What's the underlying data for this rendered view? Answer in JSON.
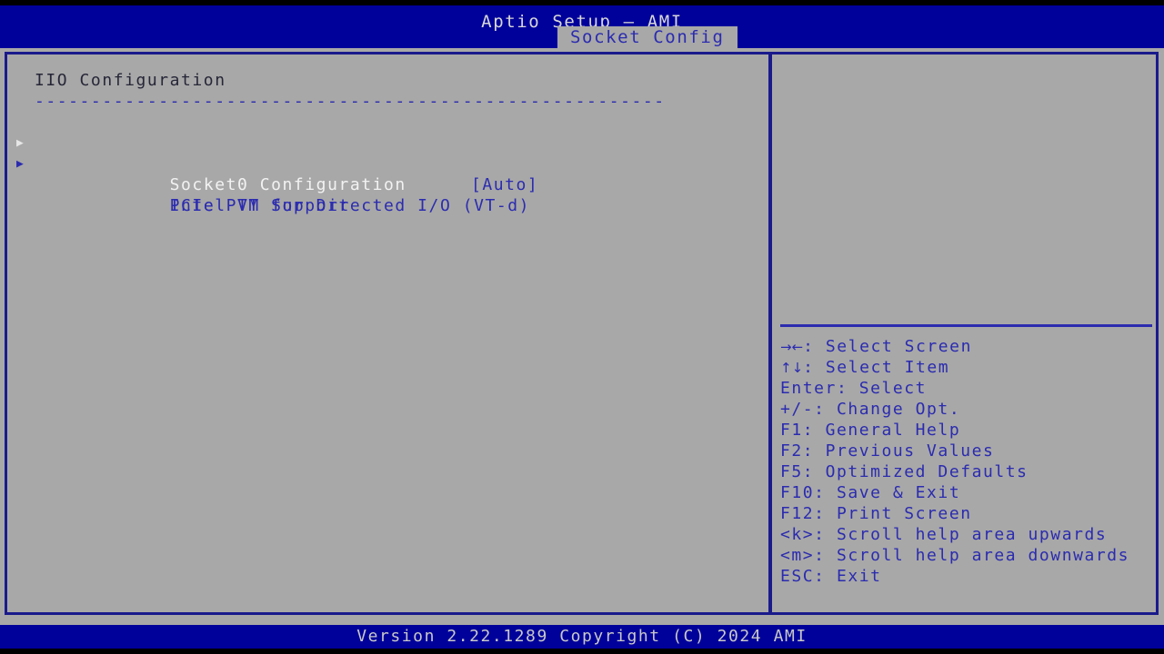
{
  "window": {
    "title": "Aptio Setup – AMI",
    "colors": {
      "header_blue": "#00009b",
      "panel_gray": "#a8a8a8",
      "border_blue": "#1a1a8c",
      "text_blue": "#2b2bb0",
      "text_selected": "#f2f2f2",
      "black": "#000000"
    }
  },
  "tabs": [
    {
      "label": "Socket Config",
      "selected": true
    }
  ],
  "main": {
    "section_title": "IIO Configuration",
    "section_rule": "--------------------------------------------------------",
    "items": [
      {
        "label": "Socket0 Configuration",
        "value": "",
        "arrow": "submenu-arrow-icon",
        "selected": true
      },
      {
        "label": "Intel VT for Directed I/O (VT-d)",
        "value": "",
        "arrow": "submenu-arrow-icon",
        "selected": false
      },
      {
        "label": "PCIe PTM Support",
        "value": "[Auto]",
        "arrow": "",
        "selected": false
      }
    ]
  },
  "help": {
    "description": "",
    "keys": [
      {
        "glyph": "→←",
        "key": "",
        "sep": ": ",
        "action": "Select Screen"
      },
      {
        "glyph": "↑↓",
        "key": "",
        "sep": ": ",
        "action": "Select Item"
      },
      {
        "glyph": "",
        "key": "Enter",
        "sep": ": ",
        "action": "Select"
      },
      {
        "glyph": "",
        "key": "+/-",
        "sep": ": ",
        "action": "Change Opt."
      },
      {
        "glyph": "",
        "key": "F1",
        "sep": ": ",
        "action": "General Help"
      },
      {
        "glyph": "",
        "key": "F2",
        "sep": ": ",
        "action": "Previous Values"
      },
      {
        "glyph": "",
        "key": "F5",
        "sep": ": ",
        "action": "Optimized Defaults"
      },
      {
        "glyph": "",
        "key": "F10",
        "sep": ": ",
        "action": "Save & Exit"
      },
      {
        "glyph": "",
        "key": "F12",
        "sep": ": ",
        "action": "Print Screen"
      },
      {
        "glyph": "",
        "key": "<k>",
        "sep": ": ",
        "action": "Scroll help area upwards"
      },
      {
        "glyph": "",
        "key": "<m>",
        "sep": ": ",
        "action": "Scroll help area downwards"
      },
      {
        "glyph": "",
        "key": "ESC",
        "sep": ": ",
        "action": "Exit"
      }
    ]
  },
  "footer": {
    "version_text": "Version 2.22.1289 Copyright (C) 2024 AMI"
  }
}
